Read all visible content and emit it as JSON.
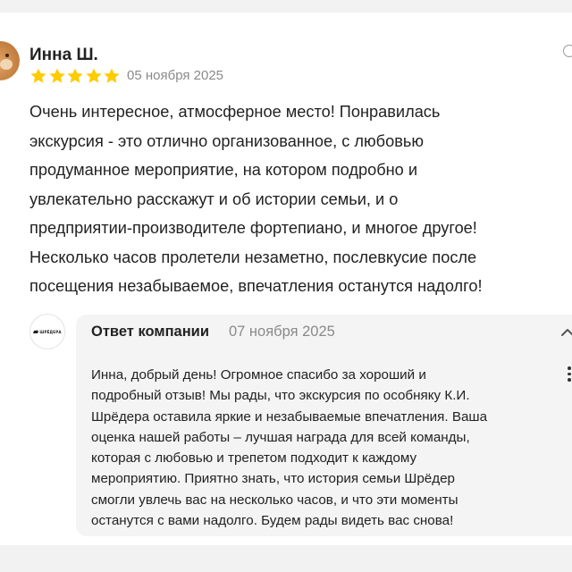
{
  "review": {
    "author": "Инна Ш.",
    "rating": 5,
    "rating_max": 5,
    "date": "05 ноября 2025",
    "text_lines": [
      "Очень интересное, атмосферное место! Понравилась",
      "экскурсия - это отлично организованное, с любовью",
      "продуманное мероприятие, на котором подробно и",
      "увлекательно расскажут и об истории семьи, и о",
      "предприятии-производителе фортепиано, и многое другое!",
      "Несколько часов пролетели незаметно, послевкусие после",
      "посещения незабываемое, впечатления останутся надолго!"
    ]
  },
  "reply": {
    "title": "Ответ компании",
    "date": "07 ноября 2025",
    "logo_text": "ШРЁДЕРА",
    "text_lines": [
      "Инна, добрый день! Огромное спасибо за хороший и",
      "подробный отзыв! Мы рады, что экскурсия по особняку К.И.",
      "Шрёдера оставила яркие и незабываемые впечатления. Ваша",
      "оценка нашей работы – лучшая награда для всей команды,",
      "которая с любовью и трепетом подходит к каждому",
      "мероприятию. Приятно знать, что история семьи Шрёдер",
      "смогли увлечь вас на несколько часов, и что эти моменты",
      "останутся с вами надолго. Будем рады видеть вас снова!"
    ]
  },
  "colors": {
    "star": "#fc0",
    "muted_text": "#8a8a8a",
    "reply_bg": "#f4f4f4"
  },
  "icons": {
    "collapse": "chevron-up-icon",
    "more": "vertical-dots-icon"
  }
}
